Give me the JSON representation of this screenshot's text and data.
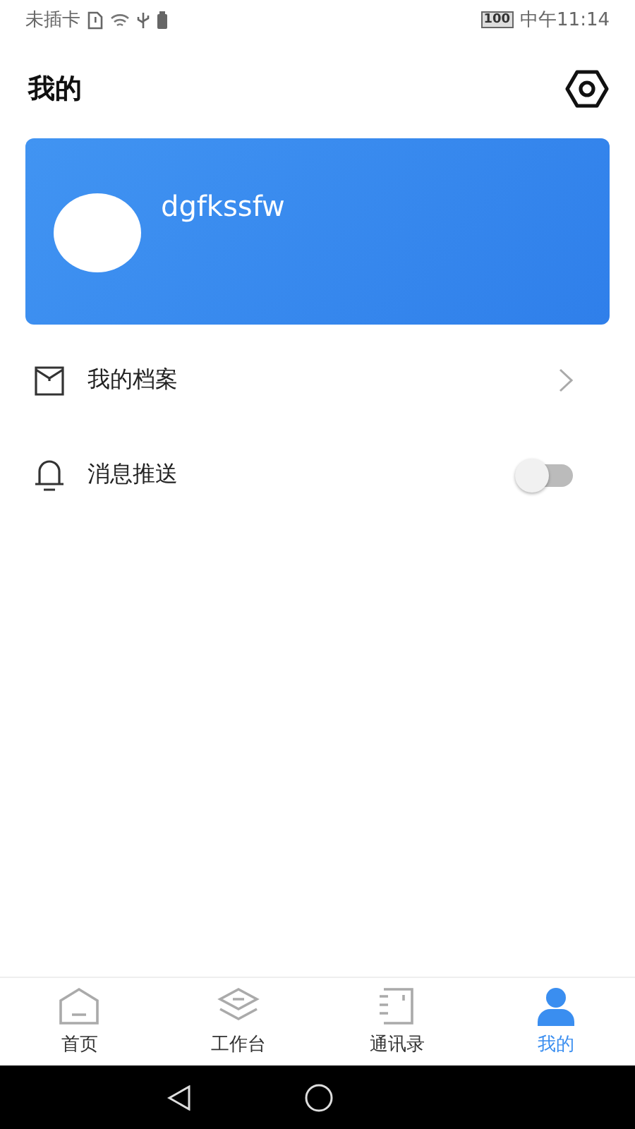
{
  "status_bar": {
    "carrier": "未插卡",
    "battery": "100",
    "time": "中午11:14"
  },
  "header": {
    "title": "我的"
  },
  "profile": {
    "username": "dgfkssfw"
  },
  "menu": [
    {
      "kind": "link",
      "label": "我的档案"
    },
    {
      "kind": "toggle",
      "label": "消息推送",
      "on": false
    }
  ],
  "tabs": [
    {
      "label": "首页",
      "selected": false
    },
    {
      "label": "工作台",
      "selected": false
    },
    {
      "label": "通讯录",
      "selected": false
    },
    {
      "label": "我的",
      "selected": true
    }
  ]
}
